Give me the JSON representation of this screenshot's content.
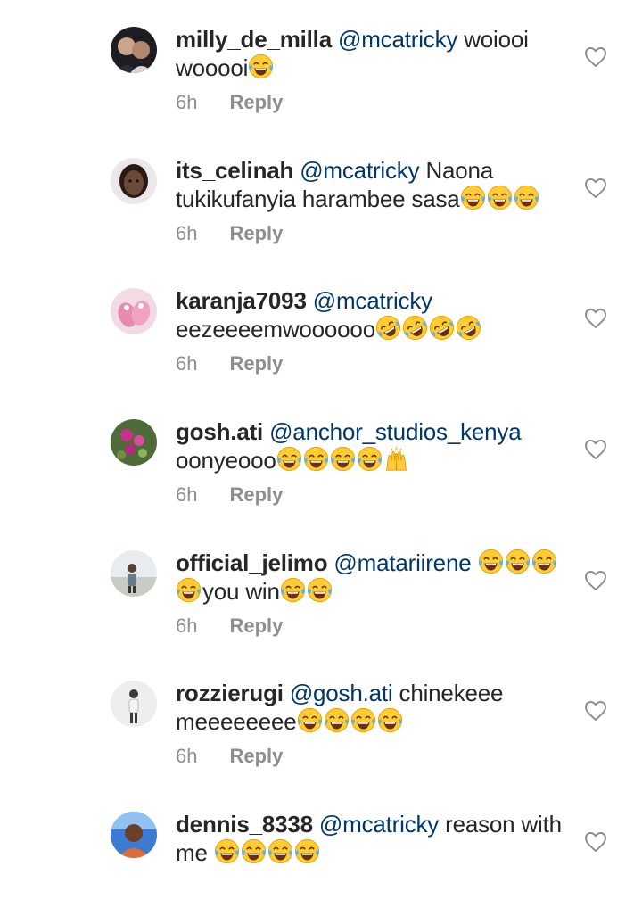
{
  "comments": [
    {
      "username": "milly_de_milla",
      "mention": "@mcatricky",
      "body": [
        {
          "t": "text",
          "v": "woiooi"
        },
        {
          "t": "br"
        },
        {
          "t": "text",
          "v": "wooooi"
        },
        {
          "t": "emoji",
          "v": "😂"
        }
      ],
      "time": "6h",
      "reply_label": "Reply",
      "avatar": {
        "icon": "couple-photo-avatar",
        "bg": "#1e1e22",
        "fg": "#d8d4d4"
      }
    },
    {
      "username": "its_celinah",
      "mention": "@mcatricky",
      "body": [
        {
          "t": "text",
          "v": "Naona"
        },
        {
          "t": "br"
        },
        {
          "t": "text",
          "v": "tukikufanyia harambee sasa"
        },
        {
          "t": "emoji",
          "v": "😂"
        },
        {
          "t": "emoji",
          "v": "😂"
        },
        {
          "t": "emoji",
          "v": "😂"
        }
      ],
      "time": "6h",
      "reply_label": "Reply",
      "avatar": {
        "icon": "selfie-photo-avatar",
        "bg": "#ece8ea",
        "fg": "#6b4a3a"
      }
    },
    {
      "username": "karanja7093",
      "mention": "@mcatricky",
      "body": [
        {
          "t": "br"
        },
        {
          "t": "text",
          "v": "eezeeeemwoooooo"
        },
        {
          "t": "emoji",
          "v": "🤣"
        },
        {
          "t": "emoji",
          "v": "🤣"
        },
        {
          "t": "emoji",
          "v": "🤣"
        },
        {
          "t": "emoji",
          "v": "🤣"
        }
      ],
      "time": "6h",
      "reply_label": "Reply",
      "avatar": {
        "icon": "pink-slippers-avatar",
        "bg": "#f3dbe5",
        "fg": "#e58bb0"
      }
    },
    {
      "username": "gosh.ati",
      "mention": "@anchor_studios_kenya",
      "body": [
        {
          "t": "br"
        },
        {
          "t": "text",
          "v": "oonyeooo"
        },
        {
          "t": "emoji",
          "v": "😂"
        },
        {
          "t": "emoji",
          "v": "😂"
        },
        {
          "t": "emoji",
          "v": "😂"
        },
        {
          "t": "emoji",
          "v": "😂"
        },
        {
          "t": "emoji",
          "v": "🙌"
        }
      ],
      "time": "6h",
      "reply_label": "Reply",
      "avatar": {
        "icon": "flowers-photo-avatar",
        "bg": "#4f6b39",
        "fg": "#c4338a"
      }
    },
    {
      "username": "official_jelimo",
      "mention": "@matariirene",
      "body": [
        {
          "t": "text",
          "v": " "
        },
        {
          "t": "emoji",
          "v": "😂"
        },
        {
          "t": "emoji",
          "v": "😂"
        },
        {
          "t": "emoji",
          "v": "😂"
        },
        {
          "t": "br"
        },
        {
          "t": "emoji",
          "v": "😂"
        },
        {
          "t": "text",
          "v": "you win"
        },
        {
          "t": "emoji",
          "v": "😂"
        },
        {
          "t": "emoji",
          "v": "😂"
        }
      ],
      "time": "6h",
      "reply_label": "Reply",
      "avatar": {
        "icon": "person-outdoor-avatar",
        "bg": "#e9ecef",
        "fg": "#6b7a8a"
      }
    },
    {
      "username": "rozzierugi",
      "mention": "@gosh.ati",
      "body": [
        {
          "t": "text",
          "v": "chinekeee"
        },
        {
          "t": "br"
        },
        {
          "t": "text",
          "v": "meeeeeeee"
        },
        {
          "t": "emoji",
          "v": "😂"
        },
        {
          "t": "emoji",
          "v": "😂"
        },
        {
          "t": "emoji",
          "v": "😂"
        },
        {
          "t": "emoji",
          "v": "😂"
        }
      ],
      "time": "6h",
      "reply_label": "Reply",
      "avatar": {
        "icon": "person-standing-avatar",
        "bg": "#eeeeee",
        "fg": "#3a3a3a"
      }
    },
    {
      "username": "dennis_8338",
      "mention": "@mcatricky",
      "body": [
        {
          "t": "text",
          "v": "reason with"
        },
        {
          "t": "br"
        },
        {
          "t": "text",
          "v": "me "
        },
        {
          "t": "emoji",
          "v": "😂"
        },
        {
          "t": "emoji",
          "v": "😂"
        },
        {
          "t": "emoji",
          "v": "😂"
        },
        {
          "t": "emoji",
          "v": "😂"
        }
      ],
      "time": "",
      "reply_label": "",
      "avatar": {
        "icon": "person-portrait-avatar",
        "bg": "#3b7bd1",
        "fg": "#e06b3a"
      }
    }
  ],
  "colors": {
    "username": "#262626",
    "mention": "#00376b",
    "meta": "#8e8e8e",
    "heart_outline": "#8e8e8e",
    "emoji_face": "#ffcc33"
  },
  "icons": {
    "like": "heart-outline-icon"
  }
}
